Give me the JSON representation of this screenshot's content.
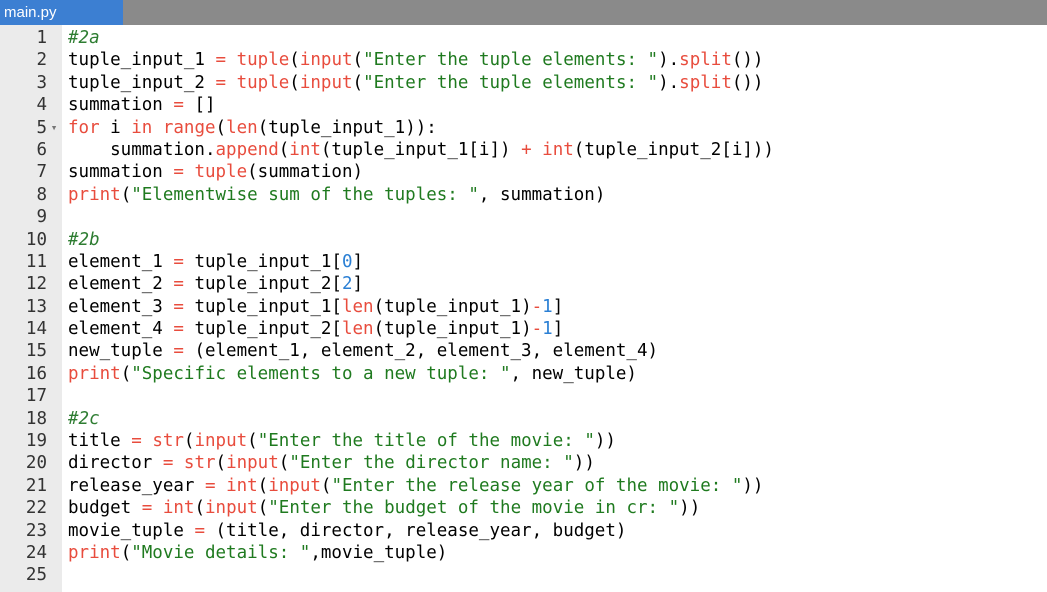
{
  "tab": {
    "label": "main.py"
  },
  "colors": {
    "tab_active": "#3c7fd2",
    "tabbar": "#8a8a8a",
    "gutter": "#ebebeb",
    "builtin": "#e84c3d",
    "string": "#1f7a1f",
    "number": "#2a7fd4",
    "comment": "#2e7d32"
  },
  "editor": {
    "lines": [
      {
        "num": "1",
        "fold": false,
        "tokens": [
          {
            "t": "#2a",
            "c": "comment"
          }
        ]
      },
      {
        "num": "2",
        "fold": false,
        "tokens": [
          {
            "t": "tuple_input_1 ",
            "c": "plain"
          },
          {
            "t": "=",
            "c": "operator"
          },
          {
            "t": " ",
            "c": "plain"
          },
          {
            "t": "tuple",
            "c": "builtin"
          },
          {
            "t": "(",
            "c": "plain"
          },
          {
            "t": "input",
            "c": "builtin"
          },
          {
            "t": "(",
            "c": "plain"
          },
          {
            "t": "\"Enter the tuple elements: \"",
            "c": "string"
          },
          {
            "t": ").",
            "c": "plain"
          },
          {
            "t": "split",
            "c": "builtin"
          },
          {
            "t": "())",
            "c": "plain"
          }
        ]
      },
      {
        "num": "3",
        "fold": false,
        "tokens": [
          {
            "t": "tuple_input_2 ",
            "c": "plain"
          },
          {
            "t": "=",
            "c": "operator"
          },
          {
            "t": " ",
            "c": "plain"
          },
          {
            "t": "tuple",
            "c": "builtin"
          },
          {
            "t": "(",
            "c": "plain"
          },
          {
            "t": "input",
            "c": "builtin"
          },
          {
            "t": "(",
            "c": "plain"
          },
          {
            "t": "\"Enter the tuple elements: \"",
            "c": "string"
          },
          {
            "t": ").",
            "c": "plain"
          },
          {
            "t": "split",
            "c": "builtin"
          },
          {
            "t": "())",
            "c": "plain"
          }
        ]
      },
      {
        "num": "4",
        "fold": false,
        "tokens": [
          {
            "t": "summation ",
            "c": "plain"
          },
          {
            "t": "=",
            "c": "operator"
          },
          {
            "t": " []",
            "c": "plain"
          }
        ]
      },
      {
        "num": "5",
        "fold": true,
        "tokens": [
          {
            "t": "for",
            "c": "keyword"
          },
          {
            "t": " i ",
            "c": "plain"
          },
          {
            "t": "in",
            "c": "keyword"
          },
          {
            "t": " ",
            "c": "plain"
          },
          {
            "t": "range",
            "c": "builtin"
          },
          {
            "t": "(",
            "c": "plain"
          },
          {
            "t": "len",
            "c": "builtin"
          },
          {
            "t": "(tuple_input_1)):",
            "c": "plain"
          }
        ]
      },
      {
        "num": "6",
        "fold": false,
        "tokens": [
          {
            "t": "    summation.",
            "c": "plain"
          },
          {
            "t": "append",
            "c": "builtin"
          },
          {
            "t": "(",
            "c": "plain"
          },
          {
            "t": "int",
            "c": "builtin"
          },
          {
            "t": "(tuple_input_1[i]) ",
            "c": "plain"
          },
          {
            "t": "+",
            "c": "operator"
          },
          {
            "t": " ",
            "c": "plain"
          },
          {
            "t": "int",
            "c": "builtin"
          },
          {
            "t": "(tuple_input_2[i]))",
            "c": "plain"
          }
        ]
      },
      {
        "num": "7",
        "fold": false,
        "tokens": [
          {
            "t": "summation ",
            "c": "plain"
          },
          {
            "t": "=",
            "c": "operator"
          },
          {
            "t": " ",
            "c": "plain"
          },
          {
            "t": "tuple",
            "c": "builtin"
          },
          {
            "t": "(summation)",
            "c": "plain"
          }
        ]
      },
      {
        "num": "8",
        "fold": false,
        "tokens": [
          {
            "t": "print",
            "c": "builtin"
          },
          {
            "t": "(",
            "c": "plain"
          },
          {
            "t": "\"Elementwise sum of the tuples: \"",
            "c": "string"
          },
          {
            "t": ", summation)",
            "c": "plain"
          }
        ]
      },
      {
        "num": "9",
        "fold": false,
        "tokens": []
      },
      {
        "num": "10",
        "fold": false,
        "tokens": [
          {
            "t": "#2b",
            "c": "comment"
          }
        ]
      },
      {
        "num": "11",
        "fold": false,
        "tokens": [
          {
            "t": "element_1 ",
            "c": "plain"
          },
          {
            "t": "=",
            "c": "operator"
          },
          {
            "t": " tuple_input_1[",
            "c": "plain"
          },
          {
            "t": "0",
            "c": "number"
          },
          {
            "t": "]",
            "c": "plain"
          }
        ]
      },
      {
        "num": "12",
        "fold": false,
        "tokens": [
          {
            "t": "element_2 ",
            "c": "plain"
          },
          {
            "t": "=",
            "c": "operator"
          },
          {
            "t": " tuple_input_2[",
            "c": "plain"
          },
          {
            "t": "2",
            "c": "number"
          },
          {
            "t": "]",
            "c": "plain"
          }
        ]
      },
      {
        "num": "13",
        "fold": false,
        "tokens": [
          {
            "t": "element_3 ",
            "c": "plain"
          },
          {
            "t": "=",
            "c": "operator"
          },
          {
            "t": " tuple_input_1[",
            "c": "plain"
          },
          {
            "t": "len",
            "c": "builtin"
          },
          {
            "t": "(tuple_input_1)",
            "c": "plain"
          },
          {
            "t": "-",
            "c": "operator"
          },
          {
            "t": "1",
            "c": "number"
          },
          {
            "t": "]",
            "c": "plain"
          }
        ]
      },
      {
        "num": "14",
        "fold": false,
        "tokens": [
          {
            "t": "element_4 ",
            "c": "plain"
          },
          {
            "t": "=",
            "c": "operator"
          },
          {
            "t": " tuple_input_2[",
            "c": "plain"
          },
          {
            "t": "len",
            "c": "builtin"
          },
          {
            "t": "(tuple_input_1)",
            "c": "plain"
          },
          {
            "t": "-",
            "c": "operator"
          },
          {
            "t": "1",
            "c": "number"
          },
          {
            "t": "]",
            "c": "plain"
          }
        ]
      },
      {
        "num": "15",
        "fold": false,
        "tokens": [
          {
            "t": "new_tuple ",
            "c": "plain"
          },
          {
            "t": "=",
            "c": "operator"
          },
          {
            "t": " (element_1, element_2, element_3, element_4)",
            "c": "plain"
          }
        ]
      },
      {
        "num": "16",
        "fold": false,
        "tokens": [
          {
            "t": "print",
            "c": "builtin"
          },
          {
            "t": "(",
            "c": "plain"
          },
          {
            "t": "\"Specific elements to a new tuple: \"",
            "c": "string"
          },
          {
            "t": ", new_tuple)",
            "c": "plain"
          }
        ]
      },
      {
        "num": "17",
        "fold": false,
        "tokens": []
      },
      {
        "num": "18",
        "fold": false,
        "tokens": [
          {
            "t": "#2c",
            "c": "comment"
          }
        ]
      },
      {
        "num": "19",
        "fold": false,
        "tokens": [
          {
            "t": "title ",
            "c": "plain"
          },
          {
            "t": "=",
            "c": "operator"
          },
          {
            "t": " ",
            "c": "plain"
          },
          {
            "t": "str",
            "c": "builtin"
          },
          {
            "t": "(",
            "c": "plain"
          },
          {
            "t": "input",
            "c": "builtin"
          },
          {
            "t": "(",
            "c": "plain"
          },
          {
            "t": "\"Enter the title of the movie: \"",
            "c": "string"
          },
          {
            "t": "))",
            "c": "plain"
          }
        ]
      },
      {
        "num": "20",
        "fold": false,
        "tokens": [
          {
            "t": "director ",
            "c": "plain"
          },
          {
            "t": "=",
            "c": "operator"
          },
          {
            "t": " ",
            "c": "plain"
          },
          {
            "t": "str",
            "c": "builtin"
          },
          {
            "t": "(",
            "c": "plain"
          },
          {
            "t": "input",
            "c": "builtin"
          },
          {
            "t": "(",
            "c": "plain"
          },
          {
            "t": "\"Enter the director name: \"",
            "c": "string"
          },
          {
            "t": "))",
            "c": "plain"
          }
        ]
      },
      {
        "num": "21",
        "fold": false,
        "tokens": [
          {
            "t": "release_year ",
            "c": "plain"
          },
          {
            "t": "=",
            "c": "operator"
          },
          {
            "t": " ",
            "c": "plain"
          },
          {
            "t": "int",
            "c": "builtin"
          },
          {
            "t": "(",
            "c": "plain"
          },
          {
            "t": "input",
            "c": "builtin"
          },
          {
            "t": "(",
            "c": "plain"
          },
          {
            "t": "\"Enter the release year of the movie: \"",
            "c": "string"
          },
          {
            "t": "))",
            "c": "plain"
          }
        ]
      },
      {
        "num": "22",
        "fold": false,
        "tokens": [
          {
            "t": "budget ",
            "c": "plain"
          },
          {
            "t": "=",
            "c": "operator"
          },
          {
            "t": " ",
            "c": "plain"
          },
          {
            "t": "int",
            "c": "builtin"
          },
          {
            "t": "(",
            "c": "plain"
          },
          {
            "t": "input",
            "c": "builtin"
          },
          {
            "t": "(",
            "c": "plain"
          },
          {
            "t": "\"Enter the budget of the movie in cr: \"",
            "c": "string"
          },
          {
            "t": "))",
            "c": "plain"
          }
        ]
      },
      {
        "num": "23",
        "fold": false,
        "tokens": [
          {
            "t": "movie_tuple ",
            "c": "plain"
          },
          {
            "t": "=",
            "c": "operator"
          },
          {
            "t": " (title, director, release_year, budget)",
            "c": "plain"
          }
        ]
      },
      {
        "num": "24",
        "fold": false,
        "tokens": [
          {
            "t": "print",
            "c": "builtin"
          },
          {
            "t": "(",
            "c": "plain"
          },
          {
            "t": "\"Movie details: \"",
            "c": "string"
          },
          {
            "t": ",movie_tuple)",
            "c": "plain"
          }
        ]
      },
      {
        "num": "25",
        "fold": false,
        "tokens": []
      }
    ]
  },
  "icons": {
    "fold": "fold-arrow-icon"
  }
}
